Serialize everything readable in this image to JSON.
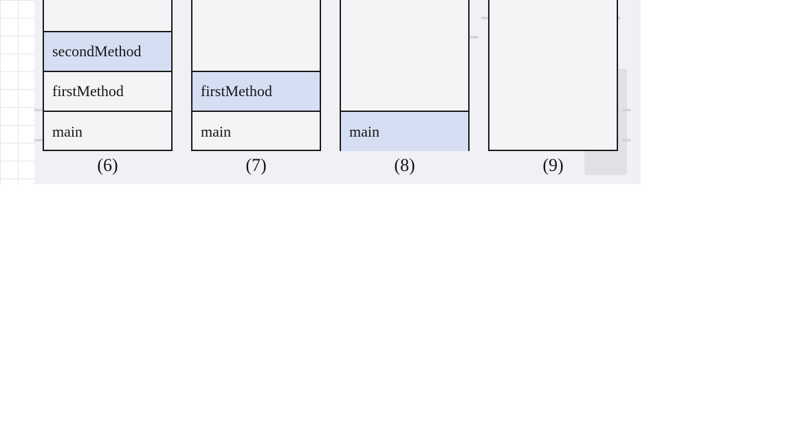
{
  "stacks": [
    {
      "caption": "(6)",
      "frames": [
        "secondMethod",
        "firstMethod",
        "main"
      ],
      "highlighted": "secondMethod"
    },
    {
      "caption": "(7)",
      "frames": [
        "firstMethod",
        "main"
      ],
      "highlighted": "firstMethod"
    },
    {
      "caption": "(8)",
      "frames": [
        "main"
      ],
      "highlighted": "main"
    },
    {
      "caption": "(9)",
      "frames": [],
      "highlighted": null
    }
  ],
  "colors": {
    "highlight": "#d6def3",
    "border": "#1a1a1a",
    "figure_bg": "#f1f0f4"
  }
}
